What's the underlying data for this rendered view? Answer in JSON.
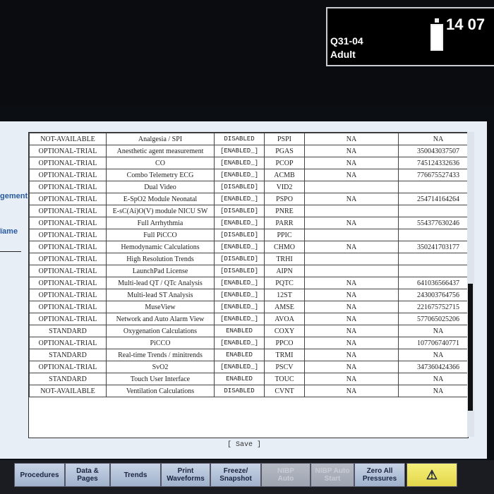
{
  "header": {
    "bed": "Q31-04",
    "category": "Adult",
    "time": "14 07"
  },
  "left_panel": {
    "label1": "gement",
    "label2": "ïame"
  },
  "table": {
    "rows": [
      [
        "NOT-AVAILABLE",
        "Analgesia / SPI",
        "DISABLED",
        "PSPI",
        "NA",
        "NA"
      ],
      [
        "OPTIONAL-TRIAL",
        "Anesthetic agent measurement",
        "[ENABLED_]",
        "PGAS",
        "NA",
        "350043037507"
      ],
      [
        "OPTIONAL-TRIAL",
        "CO",
        "[ENABLED_]",
        "PCOP",
        "NA",
        "745124332636"
      ],
      [
        "OPTIONAL-TRIAL",
        "Combo Telemetry ECG",
        "[ENABLED_]",
        "ACMB",
        "NA",
        "776675527433"
      ],
      [
        "OPTIONAL-TRIAL",
        "Dual Video",
        "[DISABLED]",
        "VID2",
        "",
        ""
      ],
      [
        "OPTIONAL-TRIAL",
        "E-SpO2 Module Neonatal",
        "[ENABLED_]",
        "PSPO",
        "NA",
        "254714164264"
      ],
      [
        "OPTIONAL-TRIAL",
        "E-sC(Ai)O(V) module NICU SW",
        "[DISABLED]",
        "PNRE",
        "",
        ""
      ],
      [
        "OPTIONAL-TRIAL",
        "Full Arrhythmia",
        "[ENABLED_]",
        "PARR",
        "NA",
        "554377630246"
      ],
      [
        "OPTIONAL-TRIAL",
        "Full PiCCO",
        "[DISABLED]",
        "PPIC",
        "",
        ""
      ],
      [
        "OPTIONAL-TRIAL",
        "Hemodynamic Calculations",
        "[ENABLED_]",
        "CHMO",
        "NA",
        "350241703177"
      ],
      [
        "OPTIONAL-TRIAL",
        "High Resolution Trends",
        "[DISABLED]",
        "TRHI",
        "",
        ""
      ],
      [
        "OPTIONAL-TRIAL",
        "LaunchPad License",
        "[DISABLED]",
        "AIPN",
        "",
        ""
      ],
      [
        "OPTIONAL-TRIAL",
        "Multi-lead QT / QTc Analysis",
        "[ENABLED_]",
        "PQTC",
        "NA",
        "641036566437"
      ],
      [
        "OPTIONAL-TRIAL",
        "Multi-lead ST Analysis",
        "[ENABLED_]",
        "12ST",
        "NA",
        "243003764756"
      ],
      [
        "OPTIONAL-TRIAL",
        "MuseView",
        "[ENABLED_]",
        "AMSE",
        "NA",
        "221675752715"
      ],
      [
        "OPTIONAL-TRIAL",
        "Network and Auto Alarm View",
        "[ENABLED_]",
        "AVOA",
        "NA",
        "577065025206"
      ],
      [
        "STANDARD",
        "Oxygenation Calculations",
        "ENABLED",
        "COXY",
        "NA",
        "NA"
      ],
      [
        "OPTIONAL-TRIAL",
        "PiCCO",
        "[ENABLED_]",
        "PPCO",
        "NA",
        "107706740771"
      ],
      [
        "STANDARD",
        "Real-time Trends / minitrends",
        "ENABLED",
        "TRMI",
        "NA",
        "NA"
      ],
      [
        "OPTIONAL-TRIAL",
        "SvO2",
        "[ENABLED_]",
        "PSCV",
        "NA",
        "347360424366"
      ],
      [
        "STANDARD",
        "Touch User Interface",
        "ENABLED",
        "TOUC",
        "NA",
        "NA"
      ],
      [
        "NOT-AVAILABLE",
        "Ventilation Calculations",
        "DISABLED",
        "CVNT",
        "NA",
        "NA"
      ]
    ]
  },
  "save_label": "[ Save ]",
  "bottom_buttons": [
    {
      "label": "Procedures",
      "enabled": true
    },
    {
      "label": "Data &\nPages",
      "enabled": true
    },
    {
      "label": "Trends",
      "enabled": true
    },
    {
      "label": "Print\nWaveforms",
      "enabled": true
    },
    {
      "label": "Freeze/\nSnapshot",
      "enabled": true
    },
    {
      "label": "NIBP\nAuto",
      "enabled": false
    },
    {
      "label": "NIBP Auto\nStart",
      "enabled": false
    },
    {
      "label": "Zero All\nPressures",
      "enabled": true
    },
    {
      "label": "",
      "enabled": true,
      "icon": "alarm-silence-icon"
    }
  ],
  "colors": {
    "alarm_button": "#f0e66a",
    "button": "#b3c3db"
  }
}
